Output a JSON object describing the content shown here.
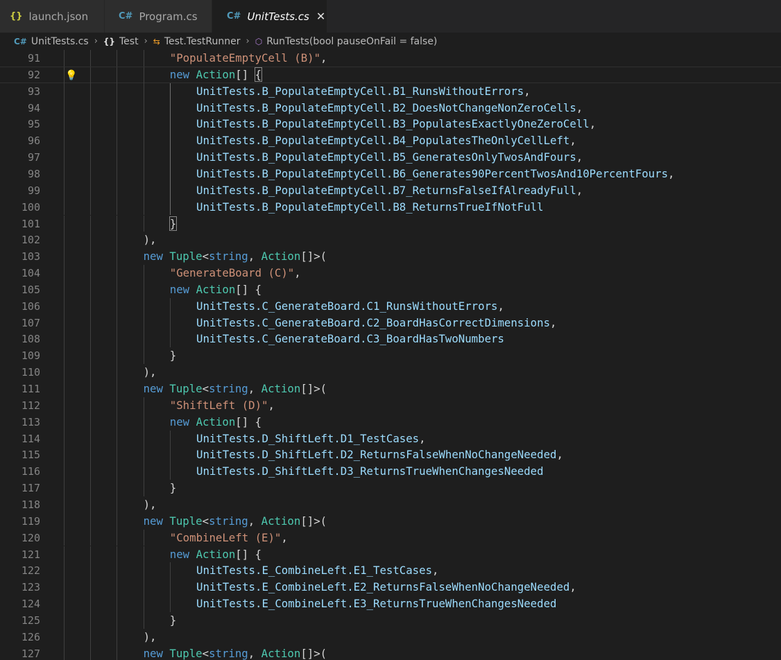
{
  "tabs": [
    {
      "icon": "{}",
      "label": "launch.json",
      "active": false
    },
    {
      "icon": "C#",
      "label": "Program.cs",
      "active": false
    },
    {
      "icon": "C#",
      "label": "UnitTests.cs",
      "active": true
    }
  ],
  "tab_close_glyph": "✕",
  "breadcrumb": [
    {
      "icon": "C#",
      "label": "UnitTests.cs"
    },
    {
      "icon": "{}",
      "label": "Test"
    },
    {
      "icon": "⇆",
      "label": "Test.TestRunner"
    },
    {
      "icon": "⬡",
      "label": "RunTests(bool pauseOnFail = false)"
    }
  ],
  "breadcrumb_separator": "›",
  "current_line": 92,
  "lines": [
    {
      "n": "91",
      "i": 4,
      "t": [
        [
          "s",
          "\"PopulateEmptyCell (B)\""
        ],
        [
          "p",
          ","
        ]
      ]
    },
    {
      "n": "92",
      "i": 4,
      "t": [
        [
          "k",
          "new"
        ],
        [
          "p",
          " "
        ],
        [
          "y",
          "Action"
        ],
        [
          "p",
          "[] "
        ],
        [
          "p",
          "{"
        ]
      ]
    },
    {
      "n": "93",
      "i": 5,
      "t": [
        [
          "i",
          "UnitTests.B_PopulateEmptyCell.B1_RunsWithoutErrors"
        ],
        [
          "p",
          ","
        ]
      ]
    },
    {
      "n": "94",
      "i": 5,
      "t": [
        [
          "i",
          "UnitTests.B_PopulateEmptyCell.B2_DoesNotChangeNonZeroCells"
        ],
        [
          "p",
          ","
        ]
      ]
    },
    {
      "n": "95",
      "i": 5,
      "t": [
        [
          "i",
          "UnitTests.B_PopulateEmptyCell.B3_PopulatesExactlyOneZeroCell"
        ],
        [
          "p",
          ","
        ]
      ]
    },
    {
      "n": "96",
      "i": 5,
      "t": [
        [
          "i",
          "UnitTests.B_PopulateEmptyCell.B4_PopulatesTheOnlyCellLeft"
        ],
        [
          "p",
          ","
        ]
      ]
    },
    {
      "n": "97",
      "i": 5,
      "t": [
        [
          "i",
          "UnitTests.B_PopulateEmptyCell.B5_GeneratesOnlyTwosAndFours"
        ],
        [
          "p",
          ","
        ]
      ]
    },
    {
      "n": "98",
      "i": 5,
      "t": [
        [
          "i",
          "UnitTests.B_PopulateEmptyCell.B6_Generates90PercentTwosAnd10PercentFours"
        ],
        [
          "p",
          ","
        ]
      ]
    },
    {
      "n": "99",
      "i": 5,
      "t": [
        [
          "i",
          "UnitTests.B_PopulateEmptyCell.B7_ReturnsFalseIfAlreadyFull"
        ],
        [
          "p",
          ","
        ]
      ]
    },
    {
      "n": "100",
      "i": 5,
      "t": [
        [
          "i",
          "UnitTests.B_PopulateEmptyCell.B8_ReturnsTrueIfNotFull"
        ]
      ]
    },
    {
      "n": "101",
      "i": 4,
      "t": [
        [
          "p",
          "}"
        ]
      ]
    },
    {
      "n": "102",
      "i": 3,
      "t": [
        [
          "p",
          "),"
        ]
      ]
    },
    {
      "n": "103",
      "i": 3,
      "t": [
        [
          "k",
          "new"
        ],
        [
          "p",
          " "
        ],
        [
          "y",
          "Tuple"
        ],
        [
          "p",
          "<"
        ],
        [
          "k",
          "string"
        ],
        [
          "p",
          ", "
        ],
        [
          "y",
          "Action"
        ],
        [
          "p",
          "[]>("
        ]
      ]
    },
    {
      "n": "104",
      "i": 4,
      "t": [
        [
          "s",
          "\"GenerateBoard (C)\""
        ],
        [
          "p",
          ","
        ]
      ]
    },
    {
      "n": "105",
      "i": 4,
      "t": [
        [
          "k",
          "new"
        ],
        [
          "p",
          " "
        ],
        [
          "y",
          "Action"
        ],
        [
          "p",
          "[] {"
        ]
      ]
    },
    {
      "n": "106",
      "i": 5,
      "t": [
        [
          "i",
          "UnitTests.C_GenerateBoard.C1_RunsWithoutErrors"
        ],
        [
          "p",
          ","
        ]
      ]
    },
    {
      "n": "107",
      "i": 5,
      "t": [
        [
          "i",
          "UnitTests.C_GenerateBoard.C2_BoardHasCorrectDimensions"
        ],
        [
          "p",
          ","
        ]
      ]
    },
    {
      "n": "108",
      "i": 5,
      "t": [
        [
          "i",
          "UnitTests.C_GenerateBoard.C3_BoardHasTwoNumbers"
        ]
      ]
    },
    {
      "n": "109",
      "i": 4,
      "t": [
        [
          "p",
          "}"
        ]
      ]
    },
    {
      "n": "110",
      "i": 3,
      "t": [
        [
          "p",
          "),"
        ]
      ]
    },
    {
      "n": "111",
      "i": 3,
      "t": [
        [
          "k",
          "new"
        ],
        [
          "p",
          " "
        ],
        [
          "y",
          "Tuple"
        ],
        [
          "p",
          "<"
        ],
        [
          "k",
          "string"
        ],
        [
          "p",
          ", "
        ],
        [
          "y",
          "Action"
        ],
        [
          "p",
          "[]>("
        ]
      ]
    },
    {
      "n": "112",
      "i": 4,
      "t": [
        [
          "s",
          "\"ShiftLeft (D)\""
        ],
        [
          "p",
          ","
        ]
      ]
    },
    {
      "n": "113",
      "i": 4,
      "t": [
        [
          "k",
          "new"
        ],
        [
          "p",
          " "
        ],
        [
          "y",
          "Action"
        ],
        [
          "p",
          "[] {"
        ]
      ]
    },
    {
      "n": "114",
      "i": 5,
      "t": [
        [
          "i",
          "UnitTests.D_ShiftLeft.D1_TestCases"
        ],
        [
          "p",
          ","
        ]
      ]
    },
    {
      "n": "115",
      "i": 5,
      "t": [
        [
          "i",
          "UnitTests.D_ShiftLeft.D2_ReturnsFalseWhenNoChangeNeeded"
        ],
        [
          "p",
          ","
        ]
      ]
    },
    {
      "n": "116",
      "i": 5,
      "t": [
        [
          "i",
          "UnitTests.D_ShiftLeft.D3_ReturnsTrueWhenChangesNeeded"
        ]
      ]
    },
    {
      "n": "117",
      "i": 4,
      "t": [
        [
          "p",
          "}"
        ]
      ]
    },
    {
      "n": "118",
      "i": 3,
      "t": [
        [
          "p",
          "),"
        ]
      ]
    },
    {
      "n": "119",
      "i": 3,
      "t": [
        [
          "k",
          "new"
        ],
        [
          "p",
          " "
        ],
        [
          "y",
          "Tuple"
        ],
        [
          "p",
          "<"
        ],
        [
          "k",
          "string"
        ],
        [
          "p",
          ", "
        ],
        [
          "y",
          "Action"
        ],
        [
          "p",
          "[]>("
        ]
      ]
    },
    {
      "n": "120",
      "i": 4,
      "t": [
        [
          "s",
          "\"CombineLeft (E)\""
        ],
        [
          "p",
          ","
        ]
      ]
    },
    {
      "n": "121",
      "i": 4,
      "t": [
        [
          "k",
          "new"
        ],
        [
          "p",
          " "
        ],
        [
          "y",
          "Action"
        ],
        [
          "p",
          "[] {"
        ]
      ]
    },
    {
      "n": "122",
      "i": 5,
      "t": [
        [
          "i",
          "UnitTests.E_CombineLeft.E1_TestCases"
        ],
        [
          "p",
          ","
        ]
      ]
    },
    {
      "n": "123",
      "i": 5,
      "t": [
        [
          "i",
          "UnitTests.E_CombineLeft.E2_ReturnsFalseWhenNoChangeNeeded"
        ],
        [
          "p",
          ","
        ]
      ]
    },
    {
      "n": "124",
      "i": 5,
      "t": [
        [
          "i",
          "UnitTests.E_CombineLeft.E3_ReturnsTrueWhenChangesNeeded"
        ]
      ]
    },
    {
      "n": "125",
      "i": 4,
      "t": [
        [
          "p",
          "}"
        ]
      ]
    },
    {
      "n": "126",
      "i": 3,
      "t": [
        [
          "p",
          "),"
        ]
      ]
    },
    {
      "n": "127",
      "i": 3,
      "t": [
        [
          "k",
          "new"
        ],
        [
          "p",
          " "
        ],
        [
          "y",
          "Tuple"
        ],
        [
          "p",
          "<"
        ],
        [
          "k",
          "string"
        ],
        [
          "p",
          ", "
        ],
        [
          "y",
          "Action"
        ],
        [
          "p",
          "[]>("
        ]
      ]
    }
  ],
  "lightbulb": "💡",
  "colors": {
    "keyword": "#569cd6",
    "type": "#4ec9b0",
    "string": "#ce9178",
    "identifier": "#9cdcfe",
    "punctuation": "#d4d4d4",
    "line_number": "#858585",
    "background": "#1e1e1e",
    "tab_bar": "#252526"
  }
}
